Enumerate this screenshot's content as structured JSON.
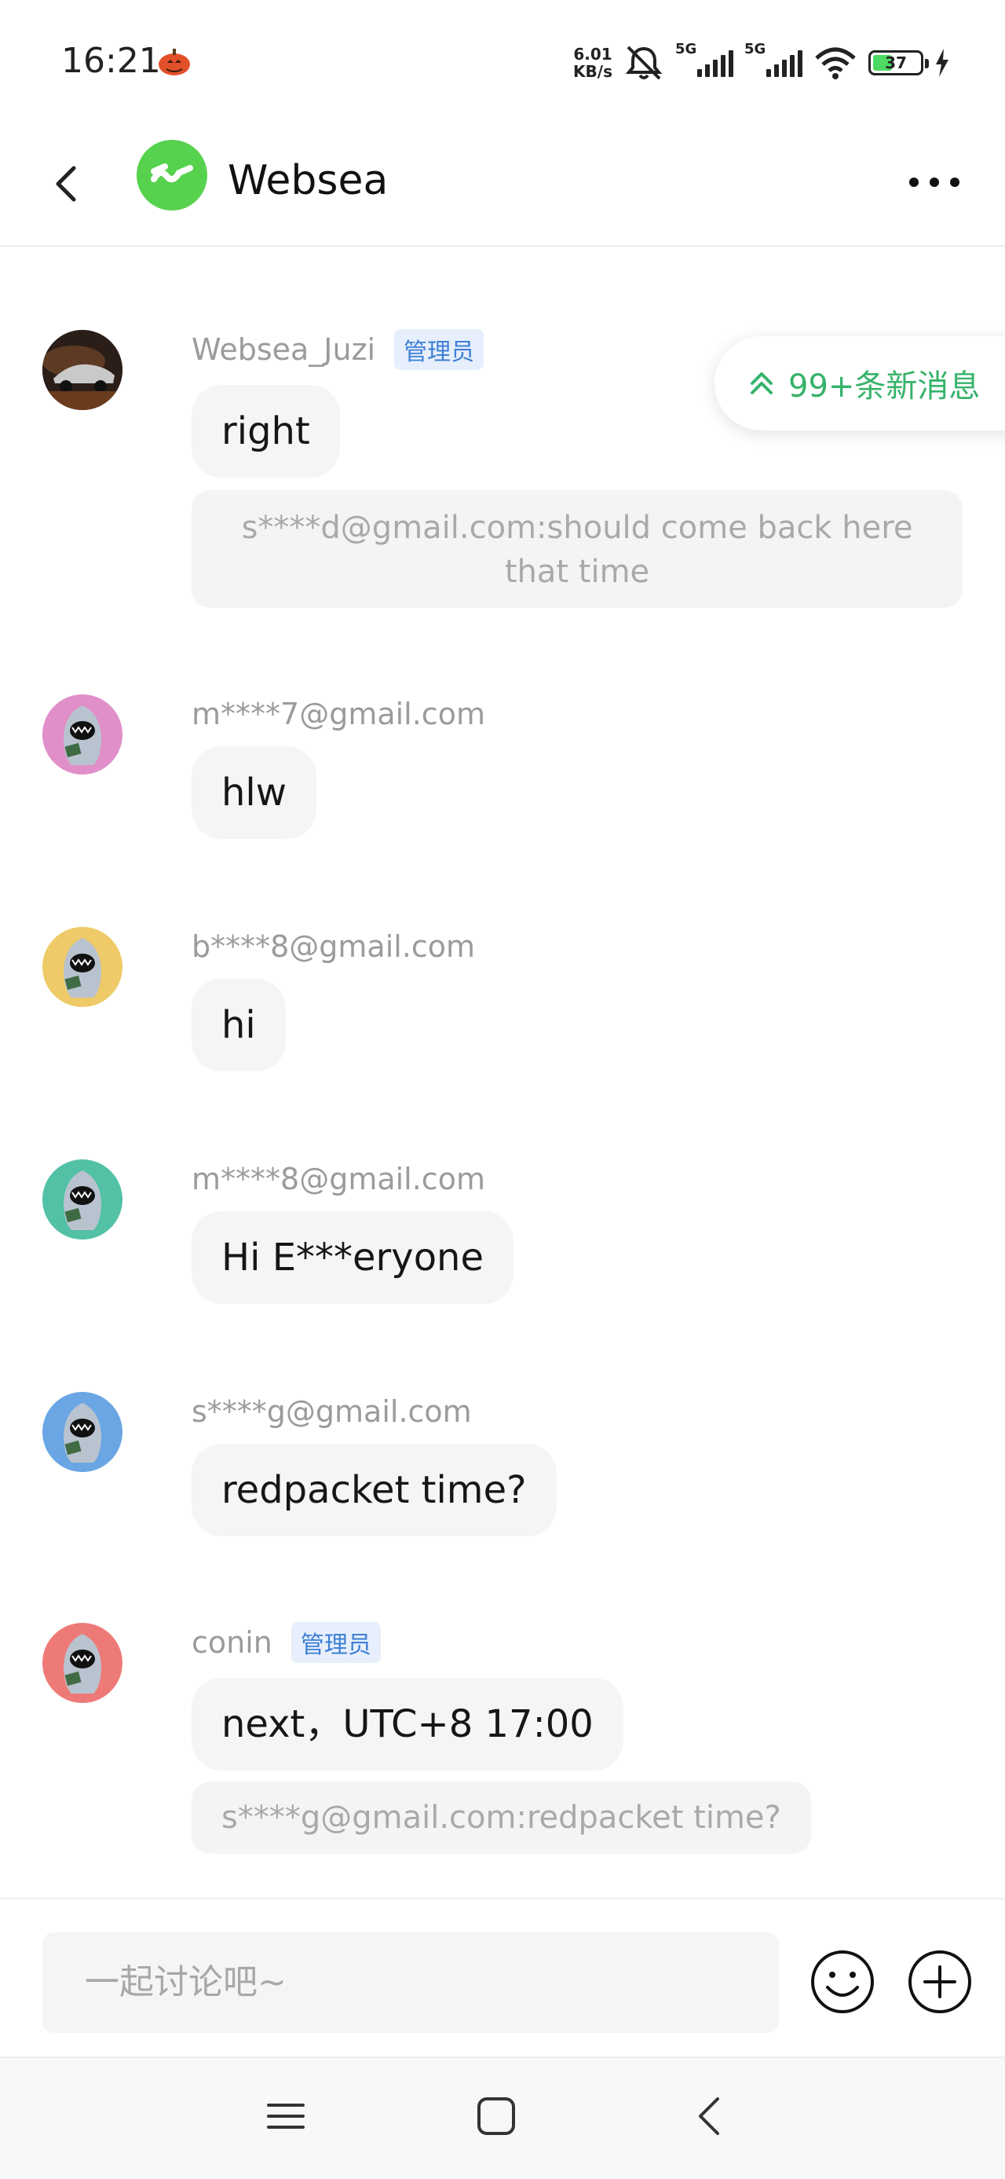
{
  "status_bar": {
    "time": "16:21",
    "net_speed_value": "6.01",
    "net_speed_unit": "KB/s",
    "signal1": "5G",
    "signal2": "5G",
    "battery": "37"
  },
  "header": {
    "channel_name": "Websea"
  },
  "new_messages": {
    "label": "99+条新消息"
  },
  "messages": [
    {
      "sender": "Websea_Juzi",
      "badge": "管理员",
      "text": "right",
      "quote": "s****d@gmail.com:should come back here that time",
      "avatar_color": "#3a2a22"
    },
    {
      "sender": "m****7@gmail.com",
      "text": "hlw",
      "avatar_color": "#e08fc9"
    },
    {
      "sender": "b****8@gmail.com",
      "text": "hi",
      "avatar_color": "#eecb68"
    },
    {
      "sender": "m****8@gmail.com",
      "text": "Hi E***eryone",
      "avatar_color": "#52c1a6"
    },
    {
      "sender": "s****g@gmail.com",
      "text": "redpacket time?",
      "avatar_color": "#6aa6e4"
    },
    {
      "sender": "conin",
      "badge": "管理员",
      "text": "next，UTC+8 17:00",
      "quote": "s****g@gmail.com:redpacket time?",
      "avatar_color": "#ee7a78"
    }
  ],
  "composer": {
    "placeholder": "一起讨论吧~"
  },
  "colors": {
    "accent_green": "#37b36b",
    "logo_green": "#57d24e",
    "admin_blue": "#3f7fd6"
  }
}
